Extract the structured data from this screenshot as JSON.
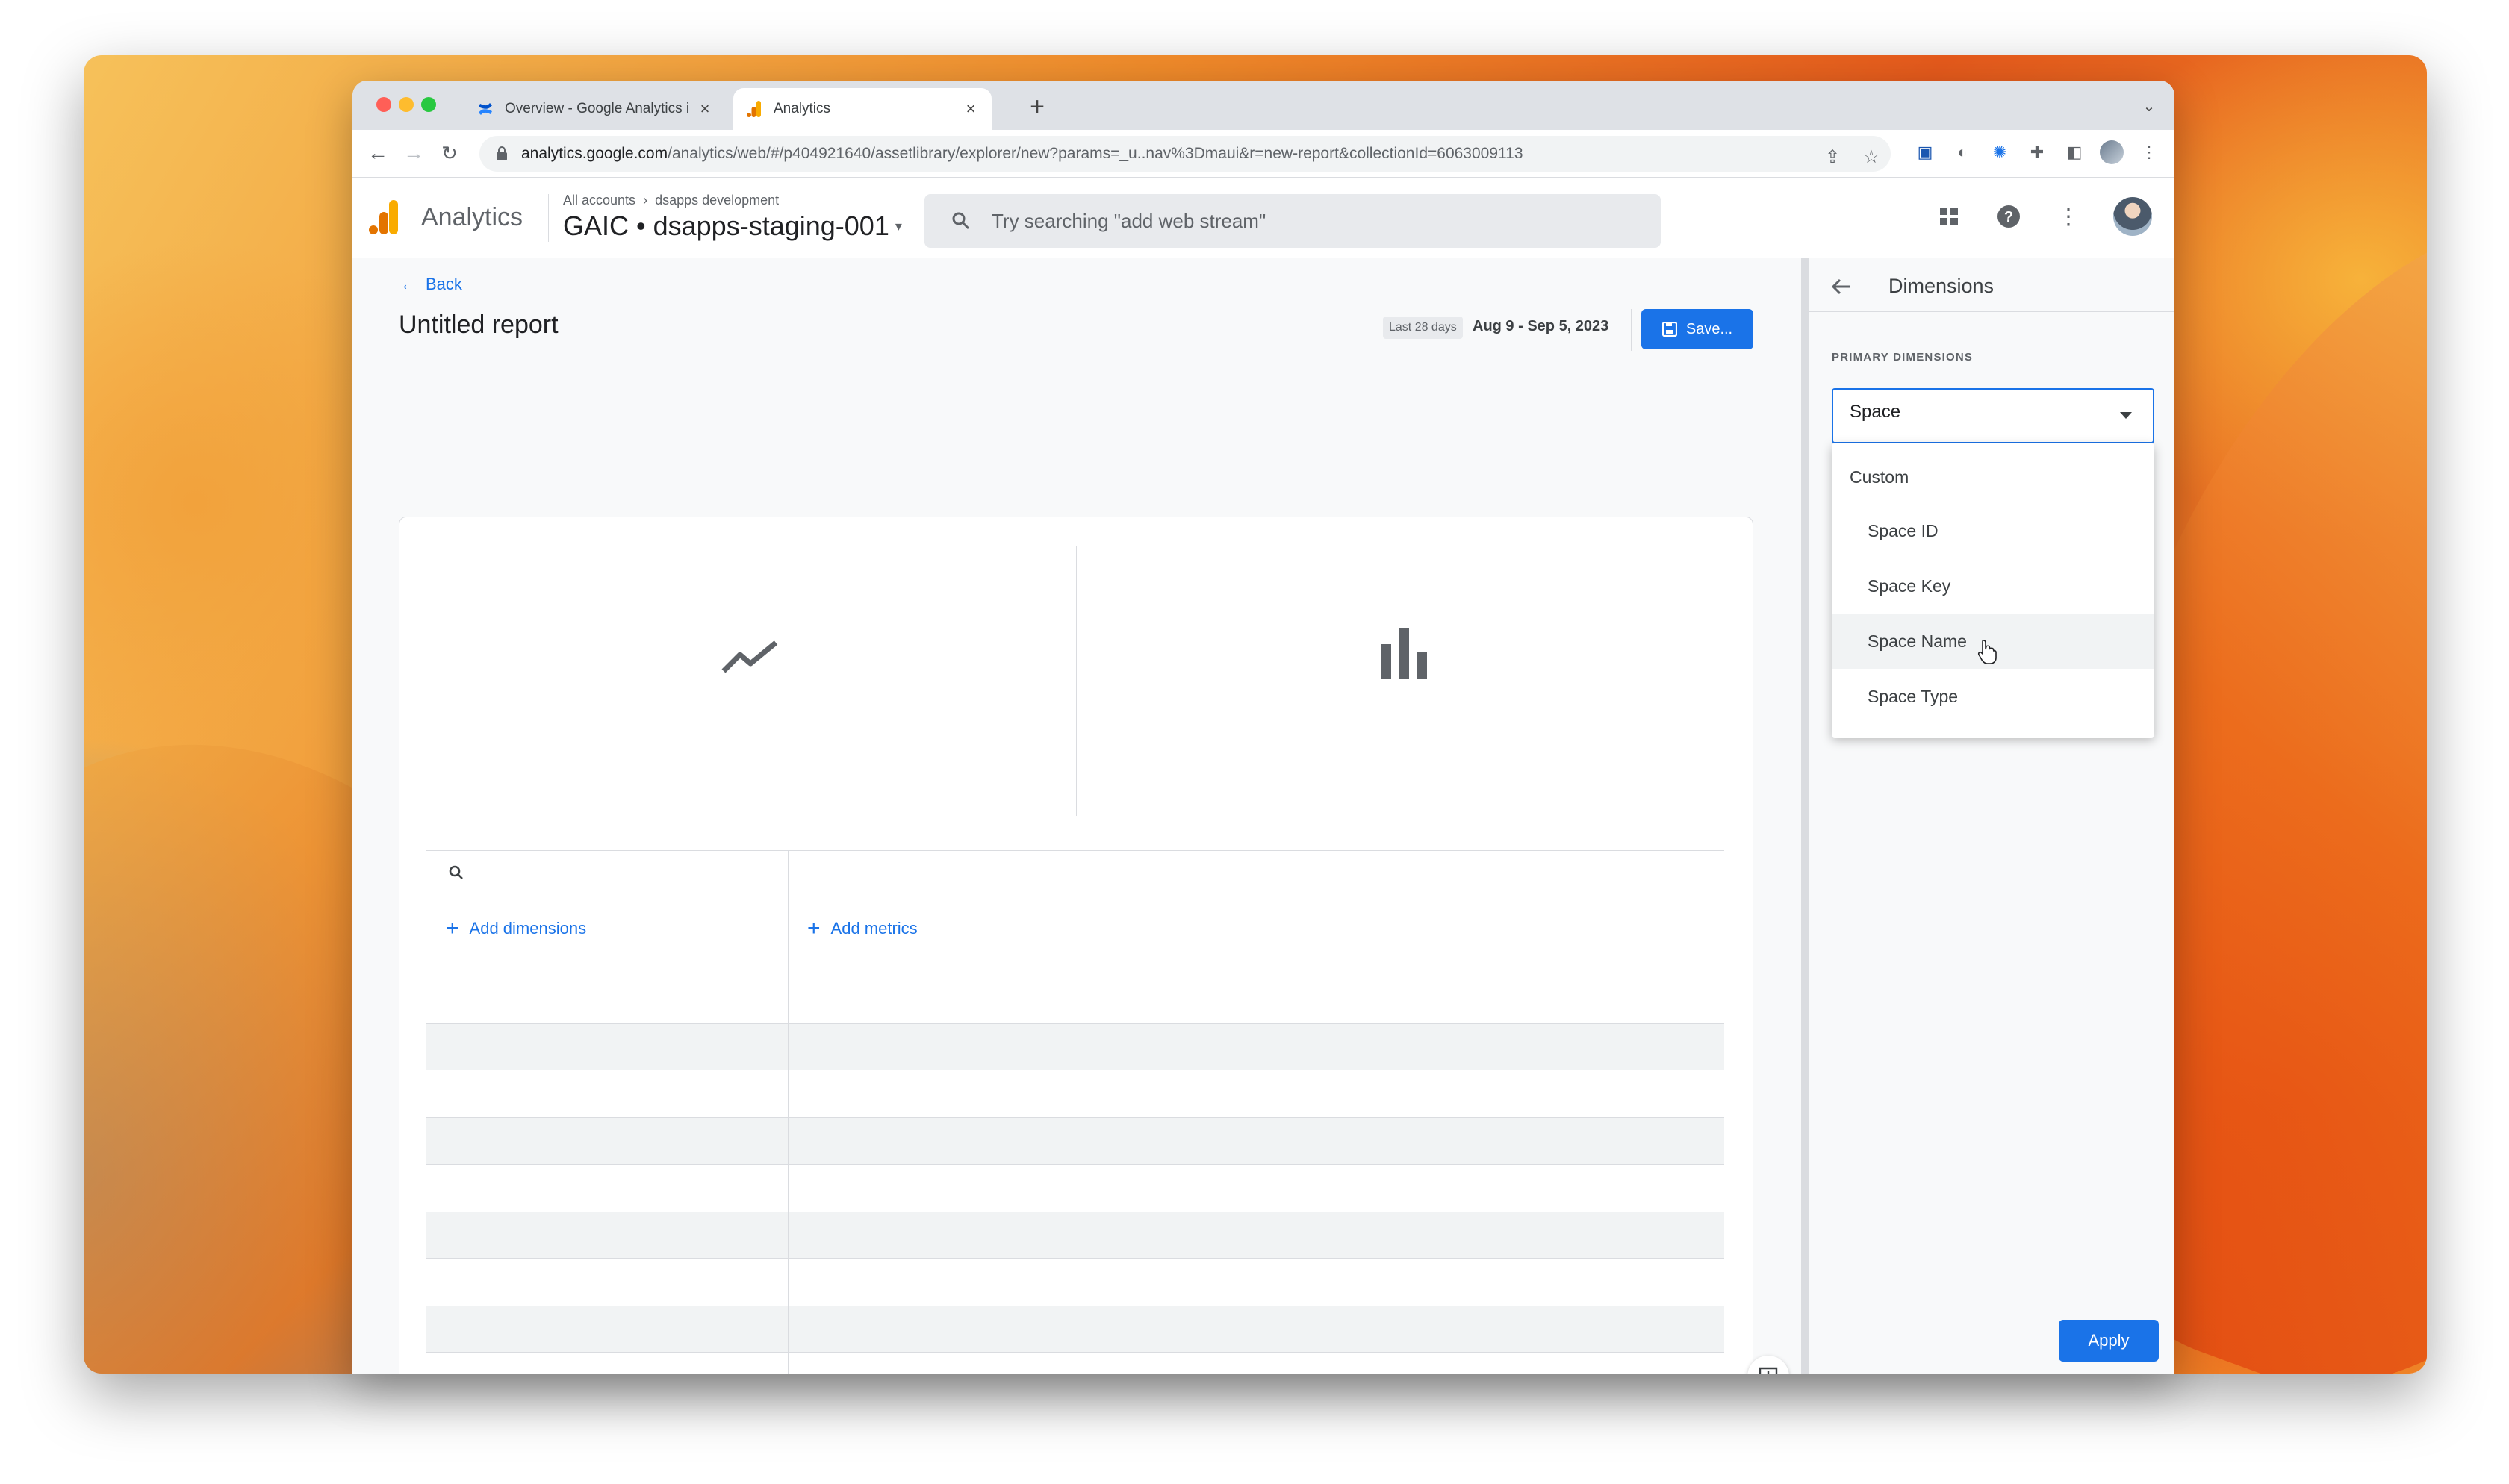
{
  "browser": {
    "tabs": [
      {
        "title": "Overview - Google Analytics i",
        "icon": "confluence-icon",
        "active": false
      },
      {
        "title": "Analytics",
        "icon": "analytics-icon",
        "active": true
      }
    ],
    "url_host": "analytics.google.com",
    "url_path": "/analytics/web/#/p404921640/assetlibrary/explorer/new?params=_u..nav%3Dmaui&r=new-report&collectionId=6063009113"
  },
  "header": {
    "product": "Analytics",
    "breadcrumb_root": "All accounts",
    "breadcrumb_account": "dsapps development",
    "property": "GAIC • dsapps-staging-001",
    "search_placeholder": "Try searching \"add web stream\""
  },
  "report": {
    "back_label": "Back",
    "title": "Untitled report",
    "date_chip": "Last 28 days",
    "date_range": "Aug 9 - Sep 5, 2023",
    "save_label": "Save..."
  },
  "table": {
    "add_dimensions": "Add dimensions",
    "add_metrics": "Add metrics"
  },
  "panel": {
    "title": "Dimensions",
    "section_label": "PRIMARY DIMENSIONS",
    "selected": "Space",
    "group": "Custom",
    "options": [
      "Space ID",
      "Space Key",
      "Space Name",
      "Space Type"
    ],
    "hovered_option": "Space Name",
    "apply_label": "Apply"
  },
  "colors": {
    "accent": "#1a73e8",
    "ga_orange": "#f9ab00",
    "ga_dark_orange": "#e37400"
  }
}
